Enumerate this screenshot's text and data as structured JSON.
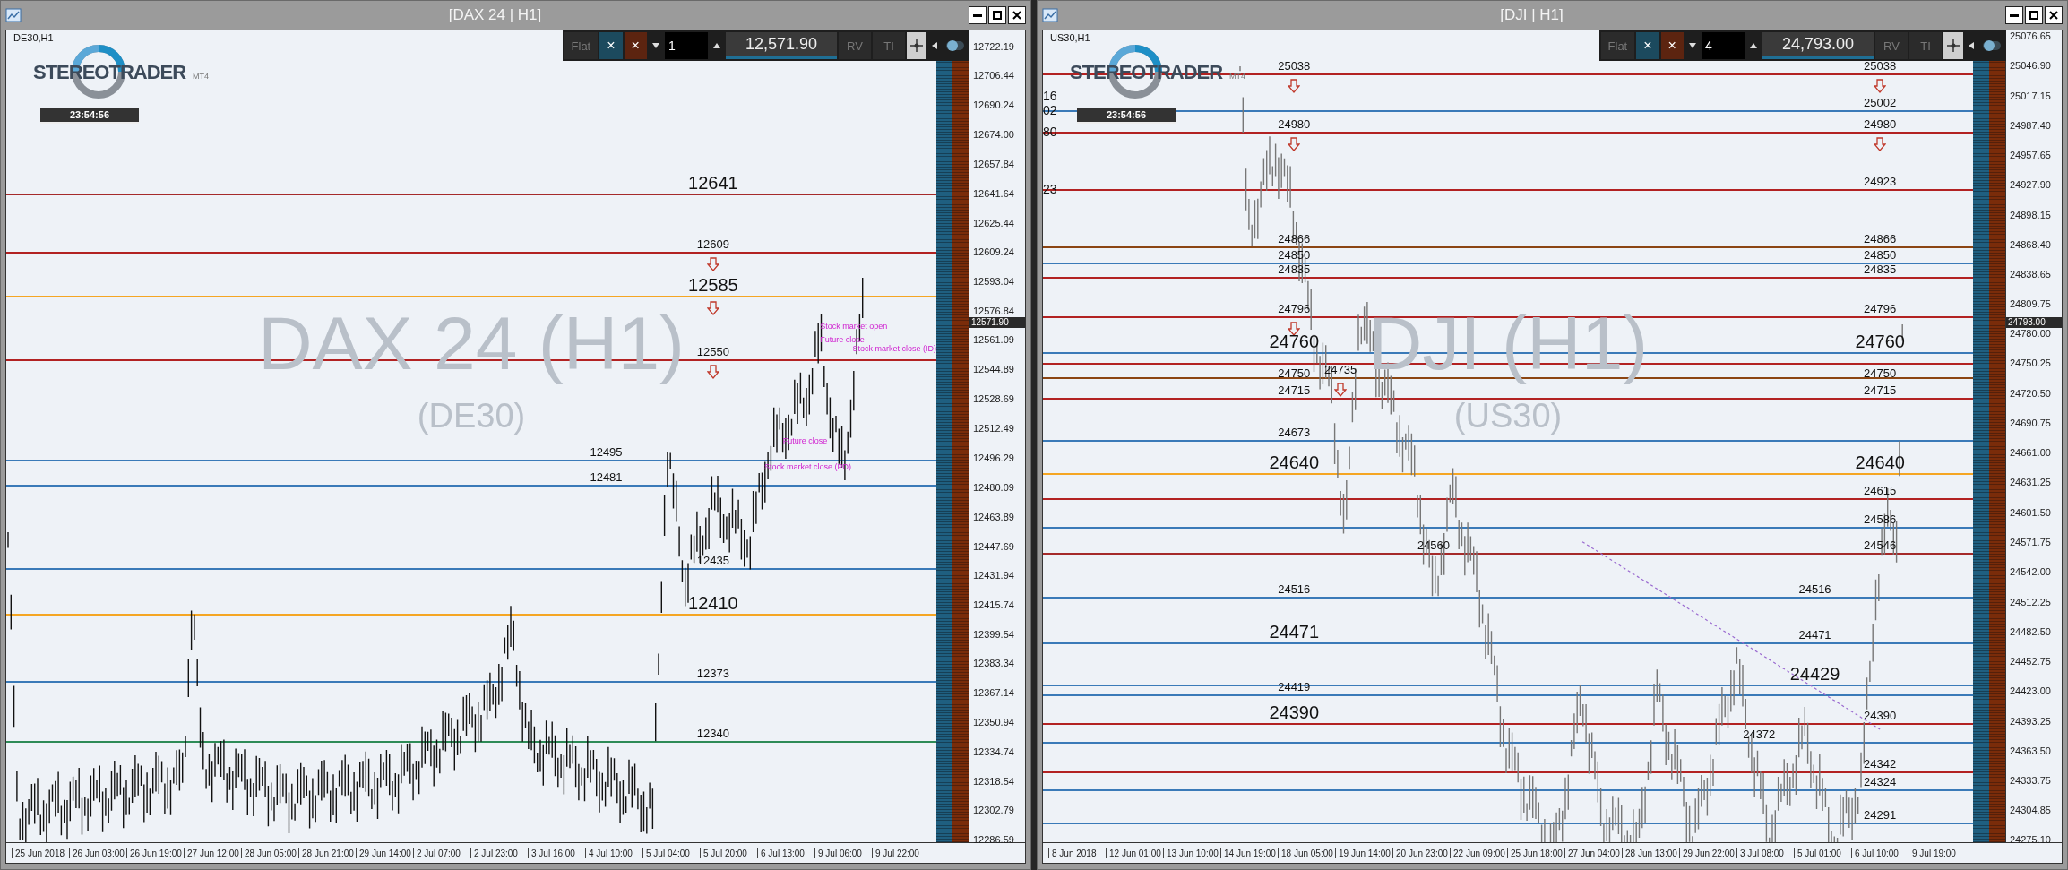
{
  "windows": [
    {
      "title": "[DAX 24 | H1]",
      "symbol": "DE30,H1",
      "logo": "STEREOTRADER",
      "logo_suffix": "MT4",
      "clock": "23:54:56",
      "watermark": "DAX 24 (H1)",
      "watermark_sub": "(DE30)",
      "toolbar": {
        "flat": "Flat",
        "close_long": "×",
        "close_short": "×",
        "quantity": "1",
        "price": "12,571.90",
        "rv": "RV",
        "ti": "TI"
      },
      "current_price": "12571.90",
      "y_ticks": [
        "12722.19",
        "12706.44",
        "12690.24",
        "12674.00",
        "12657.84",
        "12641.64",
        "12625.44",
        "12609.24",
        "12593.04",
        "12576.84",
        "12561.09",
        "12544.89",
        "12528.69",
        "12512.49",
        "12496.29",
        "12480.09",
        "12463.89",
        "12447.69",
        "12431.94",
        "12415.74",
        "12399.54",
        "12383.34",
        "12367.14",
        "12350.94",
        "12334.74",
        "12318.54",
        "12302.79",
        "12286.59"
      ],
      "x_ticks": [
        "25 Jun 2018",
        "26 Jun 03:00",
        "26 Jun 19:00",
        "27 Jun 12:00",
        "28 Jun 05:00",
        "28 Jun 21:00",
        "29 Jun 14:00",
        "2 Jul 07:00",
        "2 Jul 23:00",
        "3 Jul 16:00",
        "4 Jul 10:00",
        "5 Jul 04:00",
        "5 Jul 20:00",
        "6 Jul 13:00",
        "9 Jul 06:00",
        "9 Jul 22:00"
      ],
      "levels": [
        {
          "color": "#a52a2a",
          "labels": [
            {
              "text": "12641",
              "kind": "major",
              "arrow": false
            }
          ]
        },
        {
          "color": "#b22222",
          "labels": [
            {
              "text": "12609",
              "kind": "minor",
              "arrow": true
            }
          ]
        },
        {
          "color": "#f5a623",
          "labels": [
            {
              "text": "12585",
              "kind": "major",
              "arrow": true
            }
          ]
        },
        {
          "color": "#b22222",
          "labels": [
            {
              "text": "12550",
              "kind": "minor",
              "arrow": true
            }
          ]
        },
        {
          "color": "#3a7ab8",
          "labels": [
            {
              "text": "12495",
              "kind": "minor",
              "arrow": false
            }
          ]
        },
        {
          "color": "#3a7ab8",
          "labels": [
            {
              "text": "12481",
              "kind": "minor",
              "arrow": false
            }
          ]
        },
        {
          "color": "#3a7ab8",
          "labels": [
            {
              "text": "12435",
              "kind": "minor",
              "arrow": false
            }
          ]
        },
        {
          "color": "#f5a623",
          "labels": [
            {
              "text": "12410",
              "kind": "major",
              "arrow": false
            }
          ]
        },
        {
          "color": "#3a7ab8",
          "labels": [
            {
              "text": "12373",
              "kind": "minor",
              "arrow": false
            }
          ]
        },
        {
          "color": "#2e8b57",
          "labels": [
            {
              "text": "12340",
              "kind": "minor",
              "arrow": false
            }
          ]
        }
      ],
      "annotations": [
        "Stock market open",
        "Future close",
        "Stock market close (ID)",
        "Future close",
        "Stock market close (PD)"
      ]
    },
    {
      "title": "[DJI | H1]",
      "symbol": "US30,H1",
      "logo": "STEREOTRADER",
      "logo_suffix": "MT4",
      "clock": "23:54:56",
      "watermark": "DJI (H1)",
      "watermark_sub": "(US30)",
      "toolbar": {
        "flat": "Flat",
        "close_long": "×",
        "close_short": "×",
        "quantity": "4",
        "price": "24,793.00",
        "rv": "RV",
        "ti": "TI"
      },
      "current_price": "24793.00",
      "y_ticks": [
        "25076.65",
        "25046.90",
        "25017.15",
        "24987.40",
        "24957.65",
        "24927.90",
        "24898.15",
        "24868.40",
        "24838.65",
        "24809.75",
        "24780.00",
        "24750.25",
        "24720.50",
        "24690.75",
        "24661.00",
        "24631.25",
        "24601.50",
        "24571.75",
        "24542.00",
        "24512.25",
        "24482.50",
        "24452.75",
        "24423.00",
        "24393.25",
        "24363.50",
        "24333.75",
        "24304.85",
        "24275.10"
      ],
      "x_ticks": [
        "8 Jun 2018",
        "12 Jun 01:00",
        "13 Jun 10:00",
        "14 Jun 19:00",
        "18 Jun 05:00",
        "19 Jun 14:00",
        "20 Jun 23:00",
        "22 Jun 09:00",
        "25 Jun 18:00",
        "27 Jun 04:00",
        "28 Jun 13:00",
        "29 Jun 22:00",
        "3 Jul 08:00",
        "5 Jul 01:00",
        "6 Jul 10:00",
        "9 Jul 19:00"
      ],
      "levels": [
        {
          "color": "#b22222",
          "labels": [
            {
              "text": "25038",
              "kind": "minor",
              "arrow": true
            },
            {
              "text": "25038",
              "kind": "minor",
              "arrow": true
            }
          ]
        },
        {
          "color": "#3a7ab8",
          "labels": [
            {
              "text": "25002",
              "kind": "minor",
              "arrow": false
            }
          ]
        },
        {
          "color": "#b22222",
          "labels": [
            {
              "text": "24980",
              "kind": "minor",
              "arrow": true
            },
            {
              "text": "24980",
              "kind": "minor",
              "arrow": true
            }
          ]
        },
        {
          "color": "#b22222",
          "labels": [
            {
              "text": "24923",
              "kind": "minor",
              "arrow": false
            }
          ]
        },
        {
          "color": "#8b4513",
          "labels": [
            {
              "text": "24866",
              "kind": "minor",
              "arrow": false
            },
            {
              "text": "24866",
              "kind": "minor",
              "arrow": false
            }
          ]
        },
        {
          "color": "#3a7ab8",
          "labels": [
            {
              "text": "24850",
              "kind": "minor",
              "arrow": false
            },
            {
              "text": "24850",
              "kind": "minor",
              "arrow": false
            }
          ]
        },
        {
          "color": "#b22222",
          "labels": [
            {
              "text": "24835",
              "kind": "minor",
              "arrow": false
            },
            {
              "text": "24835",
              "kind": "minor",
              "arrow": false
            }
          ]
        },
        {
          "color": "#b22222",
          "labels": [
            {
              "text": "24796",
              "kind": "minor",
              "arrow": true
            },
            {
              "text": "24796",
              "kind": "minor",
              "arrow": false
            }
          ]
        },
        {
          "color": "#3a7ab8",
          "labels": [
            {
              "text": "24760",
              "kind": "major",
              "arrow": false
            },
            {
              "text": "24760",
              "kind": "major",
              "arrow": false
            }
          ]
        },
        {
          "color": "#b22222",
          "labels": [
            {
              "text": "24750",
              "kind": "minor",
              "arrow": false
            },
            {
              "text": "24750",
              "kind": "minor",
              "arrow": false
            }
          ]
        },
        {
          "color": "#8b4513",
          "labels": [
            {
              "text": "24735",
              "kind": "minor",
              "arrow": true
            }
          ]
        },
        {
          "color": "#b22222",
          "labels": [
            {
              "text": "24715",
              "kind": "minor",
              "arrow": false
            },
            {
              "text": "24715",
              "kind": "minor",
              "arrow": false
            }
          ]
        },
        {
          "color": "#3a7ab8",
          "labels": [
            {
              "text": "24673",
              "kind": "minor",
              "arrow": false
            }
          ]
        },
        {
          "color": "#f5a623",
          "labels": [
            {
              "text": "24640",
              "kind": "major",
              "arrow": false
            },
            {
              "text": "24640",
              "kind": "major",
              "arrow": false
            }
          ]
        },
        {
          "color": "#b22222",
          "labels": [
            {
              "text": "24615",
              "kind": "minor",
              "arrow": false
            }
          ]
        },
        {
          "color": "#3a7ab8",
          "labels": [
            {
              "text": "24586",
              "kind": "minor",
              "arrow": false
            }
          ]
        },
        {
          "color": "#a52a2a",
          "labels": [
            {
              "text": "24560",
              "kind": "minor",
              "arrow": false
            },
            {
              "text": "24546",
              "kind": "minor",
              "arrow": false
            }
          ]
        },
        {
          "color": "#3a7ab8",
          "labels": [
            {
              "text": "24516",
              "kind": "minor",
              "arrow": false
            },
            {
              "text": "24516",
              "kind": "minor",
              "arrow": false
            }
          ]
        },
        {
          "color": "#3a7ab8",
          "labels": [
            {
              "text": "24471",
              "kind": "major",
              "arrow": false
            },
            {
              "text": "24471",
              "kind": "minor",
              "arrow": false
            }
          ]
        },
        {
          "color": "#3a7ab8",
          "labels": [
            {
              "text": "24429",
              "kind": "major",
              "arrow": false
            }
          ]
        },
        {
          "color": "#3a7ab8",
          "labels": [
            {
              "text": "24419",
              "kind": "minor",
              "arrow": false
            }
          ]
        },
        {
          "color": "#b22222",
          "labels": [
            {
              "text": "24390",
              "kind": "major",
              "arrow": false
            },
            {
              "text": "24390",
              "kind": "minor",
              "arrow": false
            }
          ]
        },
        {
          "color": "#3a7ab8",
          "labels": [
            {
              "text": "24372",
              "kind": "minor",
              "arrow": false
            }
          ]
        },
        {
          "color": "#b22222",
          "labels": [
            {
              "text": "24342",
              "kind": "minor",
              "arrow": false
            }
          ]
        },
        {
          "color": "#3a7ab8",
          "labels": [
            {
              "text": "24324",
              "kind": "minor",
              "arrow": false
            }
          ]
        },
        {
          "color": "#3a7ab8",
          "labels": [
            {
              "text": "24291",
              "kind": "minor",
              "arrow": false
            }
          ]
        }
      ],
      "edge_labels": [
        "16",
        "02",
        "80",
        "23"
      ]
    }
  ]
}
